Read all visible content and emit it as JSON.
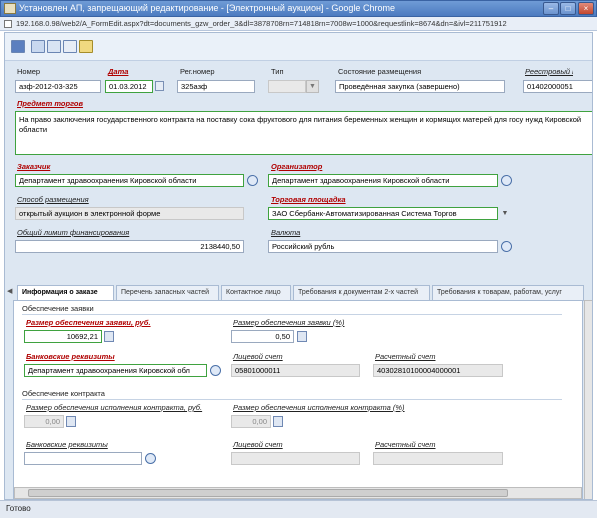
{
  "window": {
    "title": "Установлен АП, запрещающий редактирование - [Электронный аукцион] - Google Chrome"
  },
  "address": {
    "url": "192.168.0.98/web2/A_FormEdit.aspx?dt=documents_gzw_order_3&dl=3878708rn=714818rn=7008w=1000&requestlink=8674&dn=&ivl=211751912"
  },
  "form": {
    "nomer": {
      "label": "Номер",
      "value": "азф-2012-03-325"
    },
    "data": {
      "label": "Дата",
      "value": "01.03.2012"
    },
    "regnomer": {
      "label": "Рег.номер",
      "value": "325азф"
    },
    "tip": {
      "label": "Тип",
      "value": ""
    },
    "sostoyanie": {
      "label": "Состояние размещения",
      "value": "Проведённая закупка (завершено)"
    },
    "reestr": {
      "label": "Реестровый номер",
      "value": "01402000051"
    },
    "predmet": {
      "label": "Предмет торгов",
      "value": "На право заключения государственного контракта на поставку сока фруктового для питания беременных женщин и кормящих матерей для госу нужд Кировской области"
    },
    "zakazchik": {
      "label": "Заказчик",
      "value": "Департамент здравоохранения Кировской области"
    },
    "organizator": {
      "label": "Организатор",
      "value": "Департамент здравоохранения Кировской области"
    },
    "sposob": {
      "label": "Способ размещения",
      "value": "открытый аукцион в электронной форме"
    },
    "ploshadka": {
      "label": "Торговая площадка",
      "value": "ЗАО Сбербанк-Автоматизированная Система Торгов"
    },
    "limit": {
      "label": "Общий лимит финансирования",
      "value": "2138440,50"
    },
    "valuta": {
      "label": "Валюта",
      "value": "Российский рубль"
    }
  },
  "tabs": [
    "Информация о заказе",
    "Перечень запасных частей",
    "Контактное лицо",
    "Требования к документам 2-х частей",
    "Требования к товарам, работам, услуг"
  ],
  "panel": {
    "obesp_zayavki": "Обеспечение заявки",
    "razmer_rub": {
      "label": "Размер обеспечения заявки, руб.",
      "value": "10692,21"
    },
    "razmer_pct": {
      "label": "Размер обеспечения заявки (%)",
      "value": "0,50"
    },
    "bank": {
      "label": "Банковские реквизиты",
      "value": "Департамент здравоохранения Кировской обл"
    },
    "lic_schet": {
      "label": "Лицевой счет",
      "value": "05801000011"
    },
    "ras_schet": {
      "label": "Расчетный счет",
      "value": "40302810100004000001"
    },
    "obesp_kontrakta": "Обеспечение контракта",
    "k_razmer_rub": {
      "label": "Размер обеспечения исполнения контракта, руб.",
      "value": "0,00"
    },
    "k_razmer_pct": {
      "label": "Размер обеспечения исполнения контракта (%)",
      "value": "0,00"
    },
    "k_bank": {
      "label": "Банковские реквизиты",
      "value": ""
    },
    "k_lic": {
      "label": "Лицевой счет",
      "value": ""
    },
    "k_ras": {
      "label": "Расчетный счет",
      "value": ""
    }
  },
  "status": {
    "text": "Готово"
  }
}
